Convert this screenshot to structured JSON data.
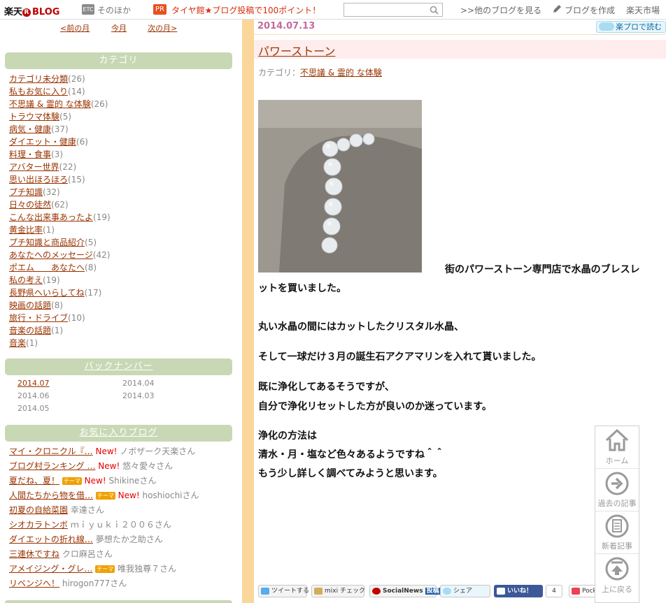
{
  "header": {
    "logo_main": "楽天",
    "logo_r": "R",
    "logo_blog": "BLOG",
    "etc_label": "ETC",
    "other": "そのほか",
    "pr_badge": "PR",
    "pr_text": "タイヤ館★ブログ投稿で100ポイント！",
    "search_placeholder": "",
    "nav_other_blogs": ">>他のブログを見る",
    "nav_create": "ブログを作成",
    "nav_market": "楽天市場"
  },
  "month_nav": {
    "prev": "<前の月",
    "current": "今月",
    "next": "次の月>"
  },
  "sidebar": {
    "category_title": "カテゴリ",
    "categories": [
      {
        "label": "カテゴリ未分類",
        "count": "(26)"
      },
      {
        "label": "私もお気に入り",
        "count": "(14)"
      },
      {
        "label": "不思議 & 霊的 な体験",
        "count": "(26)"
      },
      {
        "label": "トラウマ体験",
        "count": "(5)"
      },
      {
        "label": "病気・健康",
        "count": "(37)"
      },
      {
        "label": "ダイエット・健康",
        "count": "(6)"
      },
      {
        "label": "料理・食事",
        "count": "(3)"
      },
      {
        "label": "アバター世界",
        "count": "(22)"
      },
      {
        "label": "思い出ほろほろ",
        "count": "(15)"
      },
      {
        "label": "プチ知識",
        "count": "(32)"
      },
      {
        "label": "日々の徒然",
        "count": "(62)"
      },
      {
        "label": "こんな出来事あったよ",
        "count": "(19)"
      },
      {
        "label": "黄金比率",
        "count": "(1)"
      },
      {
        "label": "プチ知識と商品紹介",
        "count": "(5)"
      },
      {
        "label": "あなたへのメッセージ",
        "count": "(42)"
      },
      {
        "label": "ポエム　　あなたへ",
        "count": "(8)"
      },
      {
        "label": "私の考え",
        "count": "(19)"
      },
      {
        "label": "長野県へいらしてね",
        "count": "(17)"
      },
      {
        "label": "映画の話題",
        "count": "(8)"
      },
      {
        "label": "旅行・ドライブ",
        "count": "(10)"
      },
      {
        "label": "音楽の話題",
        "count": "(1)"
      },
      {
        "label": "音楽",
        "count": "(1)"
      }
    ],
    "archive_title": "バックナンバー",
    "archives": [
      "2014.07",
      "2014.04",
      "2014.06",
      "2014.03",
      "2014.05"
    ],
    "fav_title": "お気に入りブログ",
    "favorites": [
      {
        "title": "マイ・クロニクル『…",
        "theme": "",
        "new": "New!",
        "who": "ノボザーク天楽さん"
      },
      {
        "title": "ブログ村ランキング …",
        "theme": "",
        "new": "New!",
        "who": "悠々愛々さん"
      },
      {
        "title": "夏だね、夏！",
        "theme": "テーマ",
        "new": "New!",
        "who": "Shikineさん"
      },
      {
        "title": "人間たちから物を借…",
        "theme": "テーマ",
        "new": "New!",
        "who": "hoshiochiさん"
      },
      {
        "title": "初夏の自給菜園",
        "theme": "",
        "new": "",
        "who": "幸達さん"
      },
      {
        "title": "シオカラトンボ",
        "theme": "",
        "new": "",
        "who": "ｍｉｙｕｋｉ２００６さん"
      },
      {
        "title": "ダイエットの折れ線…",
        "theme": "",
        "new": "",
        "who": "夢想たか之助さん"
      },
      {
        "title": "三連休ですね",
        "theme": "",
        "new": "",
        "who": "クロ麻呂さん"
      },
      {
        "title": "アメイジング・グレ…",
        "theme": "テーマ",
        "new": "",
        "who": "唯我独尊７さん"
      },
      {
        "title": "リベンジへ！",
        "theme": "",
        "new": "",
        "who": "hirogon777さん"
      }
    ]
  },
  "entry": {
    "date": "2014.07.13",
    "pro_read": "楽プロで読む",
    "title": "パワーストーン",
    "category_prefix": "カテゴリ：",
    "category_link": "不思議 & 霊的 な体験",
    "lines": [
      "街のパワーストーン専門店で水晶のブレスレ",
      "ットを買いました。",
      "丸い水晶の間にはカットしたクリスタル水晶、",
      "そして一球だけ３月の誕生石アクアマリンを入れて貰いました。",
      "既に浄化してあるそうですが、",
      "自分で浄化リセットした方が良いのか迷っています。",
      "浄化の方法は",
      "清水・月・塩など色々あるようですね＾＾",
      "もう少し詳しく調べてみようと思います。"
    ]
  },
  "share": {
    "tweet": "ツイートする",
    "mixi": "mixi チェック",
    "socialnews": "SocialNews",
    "socialnews_post": "投稿",
    "share": "シェア",
    "like": "いいね！",
    "like_count": "4",
    "pocket": "Pocket"
  },
  "float_nav": {
    "home": "ホーム",
    "past": "過去の記事",
    "newest": "新着記事",
    "top": "上に戻る"
  },
  "colors": {
    "link": "#993300",
    "widget_head": "#c8d8b4",
    "divider": "#fbd69b",
    "title_bg": "#ffeded",
    "new_badge": "#e60000"
  }
}
